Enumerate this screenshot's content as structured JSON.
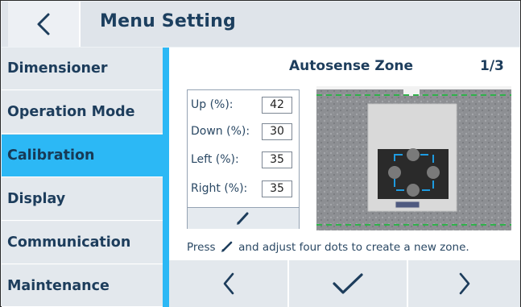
{
  "header": {
    "title": "Menu Setting",
    "back_icon": "chevron-left-icon"
  },
  "sidebar": {
    "items": [
      {
        "label": "Dimensioner",
        "active": false
      },
      {
        "label": "Operation Mode",
        "active": false
      },
      {
        "label": "Calibration",
        "active": true
      },
      {
        "label": "Display",
        "active": false
      },
      {
        "label": "Communication",
        "active": false
      },
      {
        "label": "Maintenance",
        "active": false
      }
    ]
  },
  "main": {
    "title": "Autosense Zone",
    "page": "1/3",
    "params": [
      {
        "label": "Up (%):",
        "value": "42"
      },
      {
        "label": "Down (%):",
        "value": "30"
      },
      {
        "label": "Left (%):",
        "value": "35"
      },
      {
        "label": "Right (%):",
        "value": "35"
      }
    ],
    "edit_icon": "pencil-icon",
    "hint_before": "Press",
    "hint_after": "and adjust four dots to create a new zone."
  },
  "bottom_bar": {
    "prev_icon": "chevron-left-icon",
    "confirm_icon": "checkmark-icon",
    "next_icon": "chevron-right-icon"
  },
  "colors": {
    "accent": "#2cb8f5",
    "text": "#1d3d5c",
    "zone_line": "#2fb14a",
    "dot": "#7a7a7a",
    "zone_box": "#1e9be0"
  }
}
